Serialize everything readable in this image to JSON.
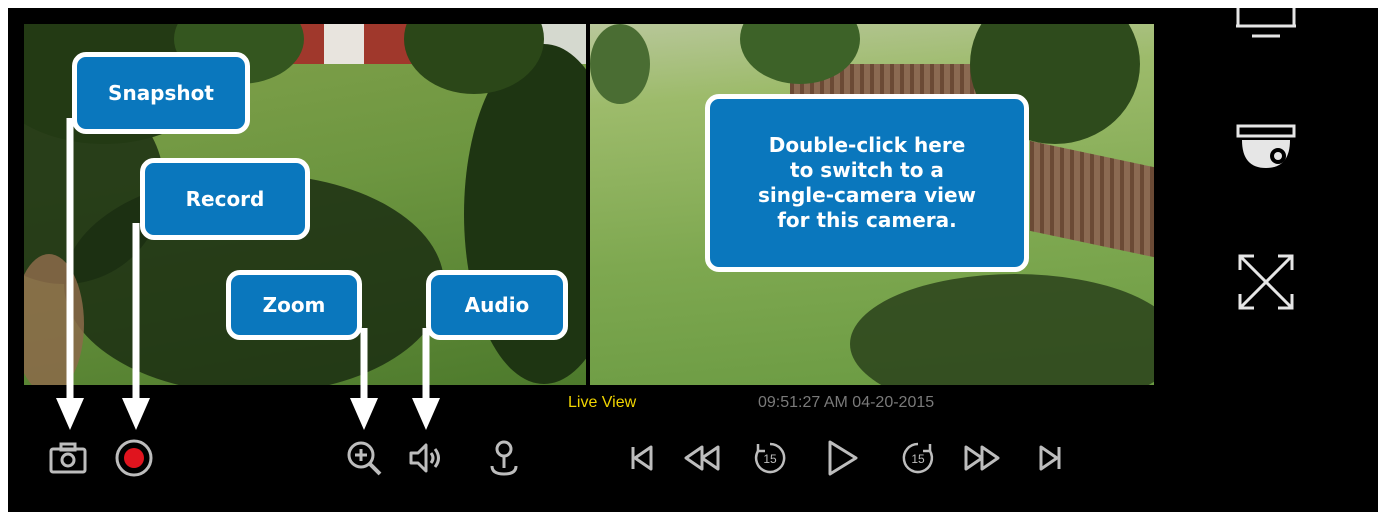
{
  "callouts": {
    "snapshot": "Snapshot",
    "record": "Record",
    "zoom": "Zoom",
    "audio": "Audio",
    "double_click_lines": [
      "Double-click here",
      "to switch to a",
      "single-camera view",
      "for this camera."
    ]
  },
  "status": {
    "mode": "Live View",
    "timestamp": "09:51:27 AM 04-20-2015"
  },
  "colors": {
    "callout_bg": "#0a77bd",
    "live_view_text": "#f0d400",
    "timestamp_text": "#7a7a7a",
    "record_dot": "#e0141e"
  },
  "toolbar": {
    "left": [
      "camera-icon",
      "record-icon"
    ],
    "middle": [
      "zoom-in-icon",
      "speaker-icon",
      "ptz-joystick-icon"
    ],
    "playback": [
      "skip-start-icon",
      "rewind-icon",
      "back-15-icon",
      "play-icon",
      "forward-15-icon",
      "fast-forward-icon",
      "skip-end-icon"
    ],
    "rewind_seconds": "15",
    "forward_seconds": "15"
  },
  "side_panel": [
    "monitor-icon",
    "dome-camera-icon",
    "fullscreen-icon"
  ]
}
